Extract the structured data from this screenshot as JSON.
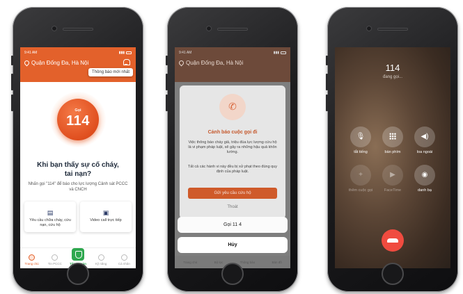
{
  "phone1": {
    "status_time": "9:41 AM",
    "location": "Quận Đống Đa, Hà Nội",
    "tooltip": "Thông báo mới nhất",
    "sos_label": "Gọi",
    "sos_number": "114",
    "title_line1": "Khi bạn thấy sự cố cháy,",
    "title_line2": "tai nạn?",
    "subtitle": "Nhấn gọi \"114\" để báo cho lực lượng Cảnh sát PCCC và CNCH",
    "card1_label": "Yêu cầu chữa cháy, cứu nạn, cứu hộ",
    "card2_label": "Video call trực tiếp",
    "tabs": [
      "Trang chủ",
      "Tin PCCC",
      "Tôi an toàn",
      "Kỹ năng",
      "Cá nhân"
    ]
  },
  "phone2": {
    "status_time": "9:41 AM",
    "location": "Quận Đống Đa, Hà Nội",
    "modal_title": "Cảnh báo cuộc gọi đi",
    "modal_text1": "Việc thông báo cháy giả, triệu đùa lực lượng cứu hộ là vi phạm pháp luật, sẽ gây ra những hậu quả khôn lường.",
    "modal_text2": "Tất cả các hành vi này đều bị xử phạt theo đúng quy định của pháp luật.",
    "modal_button": "Gửi yêu cầu cứu hộ",
    "modal_secondary": "Thoát",
    "sheet_option": "Gọi 11 4",
    "sheet_cancel": "Hủy",
    "tabs": [
      "Trang chủ",
      "Bộ lọc",
      "Thông báo",
      "Bản đồ"
    ]
  },
  "phone3": {
    "number": "114",
    "status": "đang gọi...",
    "buttons": [
      {
        "label": "tắt tiếng",
        "icon": "mic-off-icon"
      },
      {
        "label": "bàn phím",
        "icon": "keypad-icon"
      },
      {
        "label": "loa ngoài",
        "icon": "speaker-icon"
      },
      {
        "label": "thêm cuộc gọi",
        "icon": "add-call-icon"
      },
      {
        "label": "FaceTime",
        "icon": "facetime-icon"
      },
      {
        "label": "danh bạ",
        "icon": "contacts-icon"
      }
    ],
    "end_call_color": "#f04b3f"
  },
  "colors": {
    "accent": "#e3612b",
    "safe_green": "#2fa84f"
  }
}
